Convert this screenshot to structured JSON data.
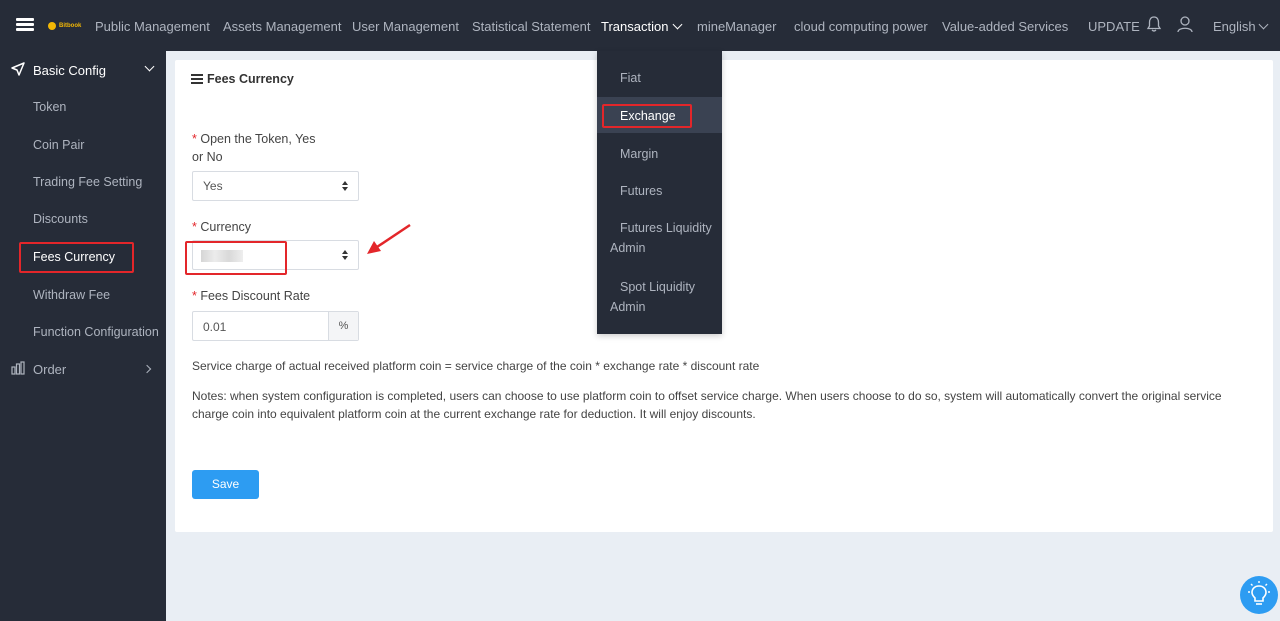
{
  "topbar": {
    "logo_text": "Bitbook",
    "nav": [
      {
        "label": "Public Management"
      },
      {
        "label": "Assets Management"
      },
      {
        "label": "User Management"
      },
      {
        "label": "Statistical Statement"
      },
      {
        "label": "Transaction"
      },
      {
        "label": "mineManager"
      },
      {
        "label": "cloud computing power"
      },
      {
        "label": "Value-added Services"
      }
    ],
    "update_label": "UPDATE",
    "language": "English"
  },
  "sidebar": {
    "group_label": "Basic Config",
    "items": [
      {
        "label": "Token"
      },
      {
        "label": "Coin Pair"
      },
      {
        "label": "Trading Fee Setting"
      },
      {
        "label": "Discounts"
      },
      {
        "label": "Fees Currency"
      },
      {
        "label": "Withdraw Fee"
      },
      {
        "label": "Function Configuration"
      }
    ],
    "order_label": "Order"
  },
  "dropdown": {
    "items": [
      {
        "label": "Fiat"
      },
      {
        "label": "Exchange"
      },
      {
        "label": "Margin"
      },
      {
        "label": "Futures"
      },
      {
        "label": "Futures Liquidity Admin"
      },
      {
        "label": "Spot Liquidity Admin"
      }
    ]
  },
  "card": {
    "title": "Fees Currency",
    "open_token": {
      "label": "Open the Token, Yes or No",
      "value": "Yes"
    },
    "currency": {
      "label": "Currency",
      "value": ""
    },
    "discount_rate": {
      "label": "Fees Discount Rate",
      "value": "0.01",
      "unit": "%"
    },
    "formula": "Service charge of actual received platform coin = service charge of the coin * exchange rate * discount rate",
    "notes": "Notes: when system configuration is completed, users can choose to use platform coin to offset service charge. When users choose to do so, system will automatically convert the original service charge coin into equivalent platform coin at the current exchange rate for deduction. It will enjoy discounts.",
    "save_label": "Save"
  },
  "colors": {
    "topbar_bg": "#262c38",
    "accent": "#2d9cf2",
    "highlight_red": "#e3262a",
    "page_bg": "#e9eef4"
  }
}
